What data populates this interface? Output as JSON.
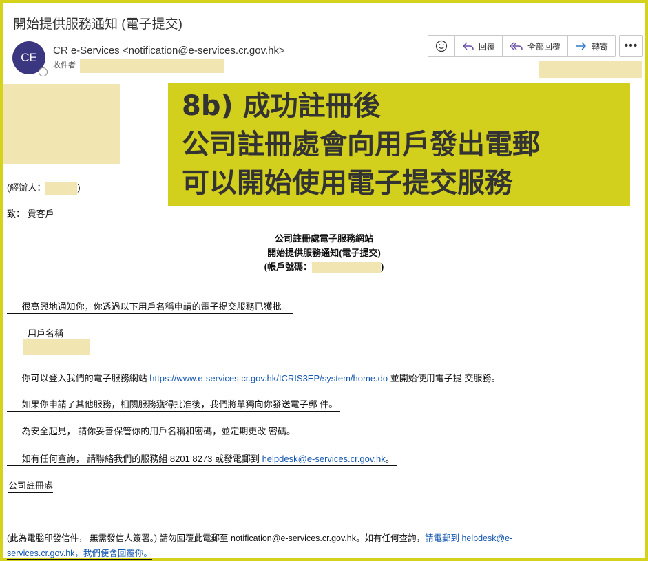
{
  "email": {
    "subject": "開始提供服務通知 (電子提交)",
    "avatar_initials": "CE",
    "sender": "CR e-Services <notification@e-services.cr.gov.hk>",
    "to_label": "收件者"
  },
  "toolbar": {
    "reply": "回覆",
    "reply_all": "全部回覆",
    "forward": "轉寄",
    "more": "•••"
  },
  "banner": {
    "line1": "8b) 成功註冊後",
    "line2": "公司註冊處會向用戶發出電郵",
    "line3": "可以開始使用電子提交服務"
  },
  "body": {
    "handler_open": "(經辦人：",
    "handler_close": ")",
    "greeting": "致：  貴客戶",
    "heading1": "公司註冊處電子服務網站",
    "heading2": "開始提供服務通知(電子提交)",
    "heading3_open": "(帳戶號碼：",
    "heading3_close": ")",
    "p1": "      很高興地通知你，你透過以下用戶名稱申請的電子提交服務已獲批。 ",
    "username_label": "用戶名稱",
    "p2_pre": "      你可以登入我們的電子服務網站 ",
    "p2_link": "https://www.e-services.cr.gov.hk/ICRIS3EP/system/home.do",
    "p2_post": " 並開始使用電子提 交服務。 ",
    "p3": "      如果你申請了其他服務，相關服務獲得批准後，我們將單獨向你發送電子郵 件。 ",
    "p4": "      為安全起見， 請你妥善保管你的用戶名稱和密碼，並定期更改 密碼。 ",
    "p5_pre": "      如有任何查詢， 請聯絡我們的服務組 8201 8273 或發電郵到 ",
    "p5_link": "helpdesk@e-services.cr.gov.hk",
    "p5_post": "。 ",
    "signature": "公司註冊處",
    "footer1_pre": "(此為電腦印發信件， 無需發信人簽署。) 請勿回覆此電郵至 notification@e-services.cr.gov.hk。如有任何查詢，",
    "footer1_link": "請電郵到 helpdesk@e-",
    "footer2_link": "services.cr.gov.hk",
    "footer2_post": "，我們便會回覆你。"
  },
  "colors": {
    "frame": "#d5d21c",
    "banner": "#d3cf1d",
    "redaction": "#f1e5b1",
    "avatar": "#3b3680",
    "link": "#1558b0"
  }
}
